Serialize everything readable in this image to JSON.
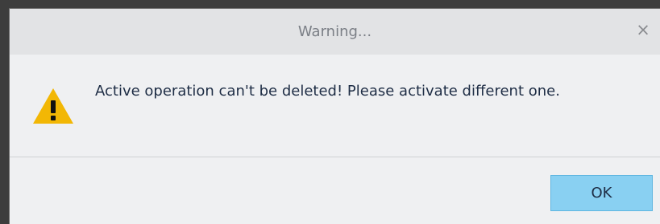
{
  "dialog": {
    "title": "Warning...",
    "close_glyph": "×",
    "message": "Active operation can't be deleted! Please activate different one.",
    "icon": "warning-icon",
    "ok_label": "OK"
  },
  "colors": {
    "warning_icon": "#f2b705",
    "button_bg": "#89d0f2",
    "dialog_bg": "#eff0f2"
  }
}
